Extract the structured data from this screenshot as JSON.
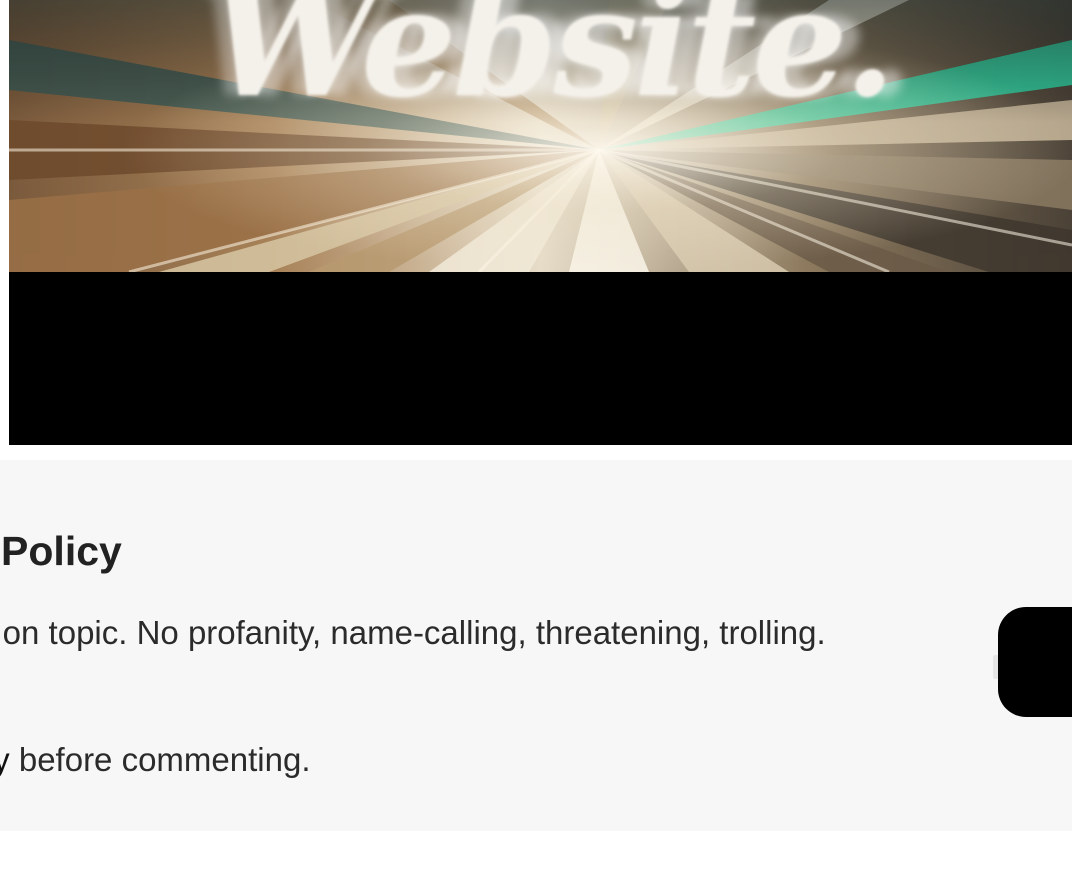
{
  "video": {
    "overlay_word": "Website."
  },
  "policy": {
    "title": "t Policy",
    "rule_text": "y on topic. No profanity, name-calling, threatening, trolling.",
    "link_text": "licy",
    "note_suffix": " before commenting.",
    "action_button_label": ""
  },
  "colors": {
    "panel_background": "#f7f7f7",
    "text": "#2b2b2b",
    "title": "#222222",
    "button": "#000000",
    "video_letterbox": "#000000"
  }
}
